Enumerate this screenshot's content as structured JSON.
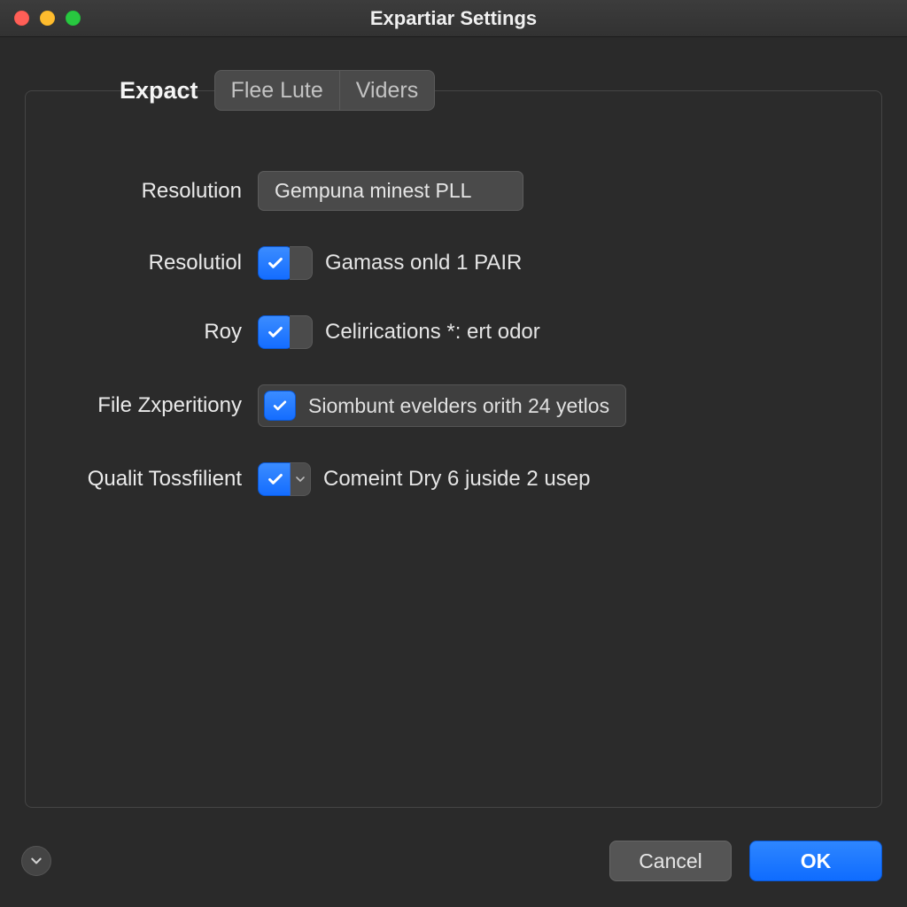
{
  "window": {
    "title": "Expartiar Settings"
  },
  "tabs": {
    "active": "Expact",
    "others": [
      "Flee Lute",
      "Viders"
    ]
  },
  "form": {
    "resolution_label": "Resolution",
    "resolution_value": "Gempuna minest PLL",
    "row1_label": "Resolutiol",
    "row1_text": "Gamass onld 1 PAIR",
    "row2_label": "Roy",
    "row2_text": "Celirications *: ert odor",
    "row3_label": "File Zxperitiony",
    "row3_text": "Siombunt evelders orith 24 yetlos",
    "row4_label": "Qualit Tossfilient",
    "row4_text": "Comeint Dry 6 juside 2 usep"
  },
  "footer": {
    "cancel": "Cancel",
    "ok": "OK"
  },
  "colors": {
    "accent": "#1d74ff"
  }
}
